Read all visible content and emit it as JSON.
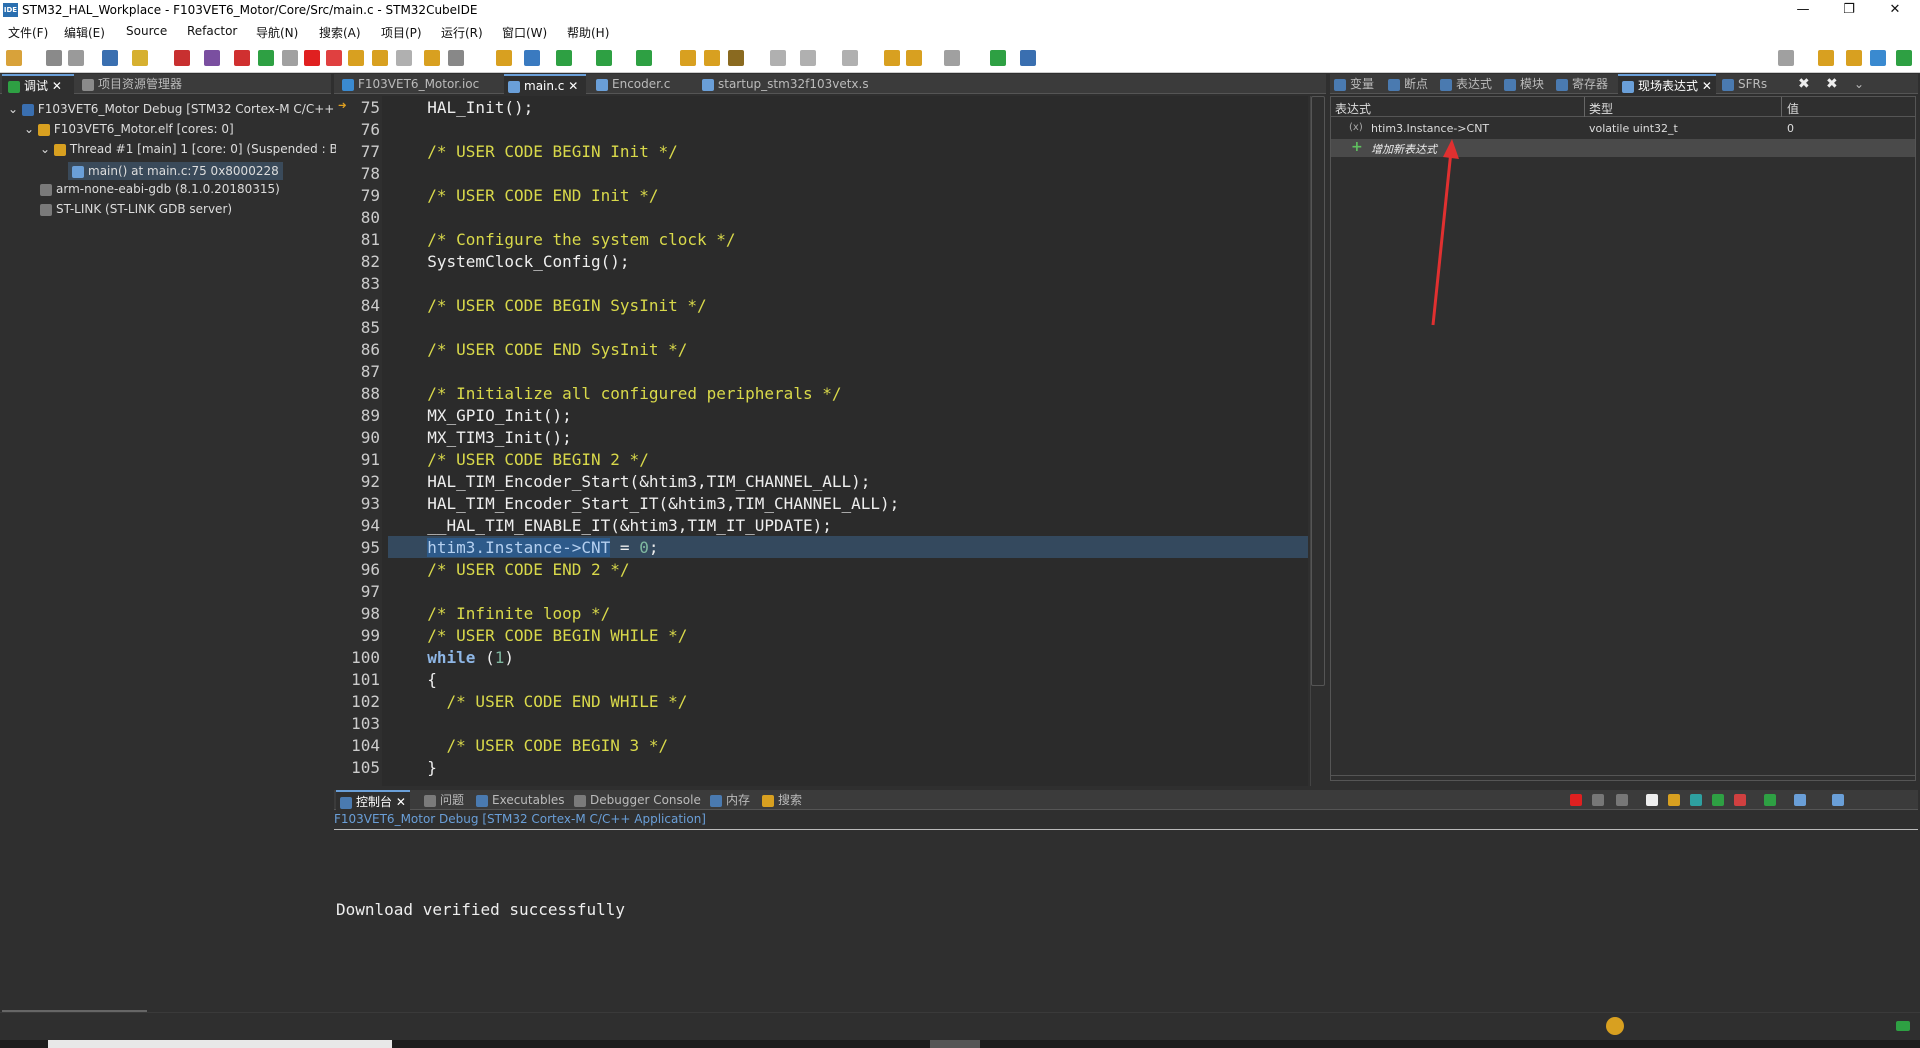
{
  "window": {
    "title": "STM32_HAL_Workplace - F103VET6_Motor/Core/Src/main.c - STM32CubeIDE",
    "logo": "IDE",
    "min": "—",
    "max": "❐",
    "close": "✕"
  },
  "menu": [
    "文件(F)",
    "编辑(E)",
    "Source",
    "Refactor",
    "导航(N)",
    "搜索(A)",
    "项目(P)",
    "运行(R)",
    "窗口(W)",
    "帮助(H)"
  ],
  "left_tabs": {
    "debug": "调试",
    "project": "项目资源管理器"
  },
  "debug_tree": [
    "F103VET6_Motor Debug [STM32 Cortex-M C/C++",
    "F103VET6_Motor.elf [cores: 0]",
    "Thread #1 [main] 1 [core: 0] (Suspended : B",
    "main() at main.c:75 0x8000228",
    "arm-none-eabi-gdb (8.1.0.20180315)",
    "ST-LINK (ST-LINK GDB server)"
  ],
  "editor_tabs": [
    "F103VET6_Motor.ioc",
    "main.c",
    "Encoder.c",
    "startup_stm32f103vetx.s"
  ],
  "code_lines": [
    {
      "n": "75",
      "t": "  HAL_Init();"
    },
    {
      "n": "76",
      "t": ""
    },
    {
      "n": "77",
      "t": "  /* USER CODE BEGIN Init */"
    },
    {
      "n": "78",
      "t": ""
    },
    {
      "n": "79",
      "t": "  /* USER CODE END Init */"
    },
    {
      "n": "80",
      "t": ""
    },
    {
      "n": "81",
      "t": "  /* Configure the system clock */"
    },
    {
      "n": "82",
      "t": "  SystemClock_Config();"
    },
    {
      "n": "83",
      "t": ""
    },
    {
      "n": "84",
      "t": "  /* USER CODE BEGIN SysInit */"
    },
    {
      "n": "85",
      "t": ""
    },
    {
      "n": "86",
      "t": "  /* USER CODE END SysInit */"
    },
    {
      "n": "87",
      "t": ""
    },
    {
      "n": "88",
      "t": "  /* Initialize all configured peripherals */"
    },
    {
      "n": "89",
      "t": "  MX_GPIO_Init();"
    },
    {
      "n": "90",
      "t": "  MX_TIM3_Init();"
    },
    {
      "n": "91",
      "t": "  /* USER CODE BEGIN 2 */"
    },
    {
      "n": "92",
      "t": "  HAL_TIM_Encoder_Start(&htim3,TIM_CHANNEL_ALL);"
    },
    {
      "n": "93",
      "t": "  HAL_TIM_Encoder_Start_IT(&htim3,TIM_CHANNEL_ALL);"
    },
    {
      "n": "94",
      "t": "  __HAL_TIM_ENABLE_IT(&htim3,TIM_IT_UPDATE);"
    },
    {
      "n": "95",
      "t": "  htim3.Instance->CNT = 0;"
    },
    {
      "n": "96",
      "t": "  /* USER CODE END 2 */"
    },
    {
      "n": "97",
      "t": ""
    },
    {
      "n": "98",
      "t": "  /* Infinite loop */"
    },
    {
      "n": "99",
      "t": "  /* USER CODE BEGIN WHILE */"
    },
    {
      "n": "100",
      "t": "  while (1)"
    },
    {
      "n": "101",
      "t": "  {"
    },
    {
      "n": "102",
      "t": "    /* USER CODE END WHILE */"
    },
    {
      "n": "103",
      "t": ""
    },
    {
      "n": "104",
      "t": "    /* USER CODE BEGIN 3 */"
    },
    {
      "n": "105",
      "t": "  }"
    }
  ],
  "right_tabs": [
    "变量",
    "断点",
    "表达式",
    "模块",
    "寄存器",
    "现场表达式",
    "SFRs"
  ],
  "expr_headers": [
    "表达式",
    "类型",
    "值"
  ],
  "expr_row": {
    "expr": "htim3.Instance->CNT",
    "type": "volatile uint32_t",
    "value": "0"
  },
  "add_expr": "增加新表达式",
  "console_tabs": [
    "控制台",
    "问题",
    "Executables",
    "Debugger Console",
    "内存",
    "搜索"
  ],
  "console_header": "F103VET6_Motor Debug [STM32 Cortex-M C/C++ Application]",
  "console_output": "Download verified successfully",
  "colors": {
    "accent": "#6a9fd8",
    "arrow": "#e03030"
  }
}
